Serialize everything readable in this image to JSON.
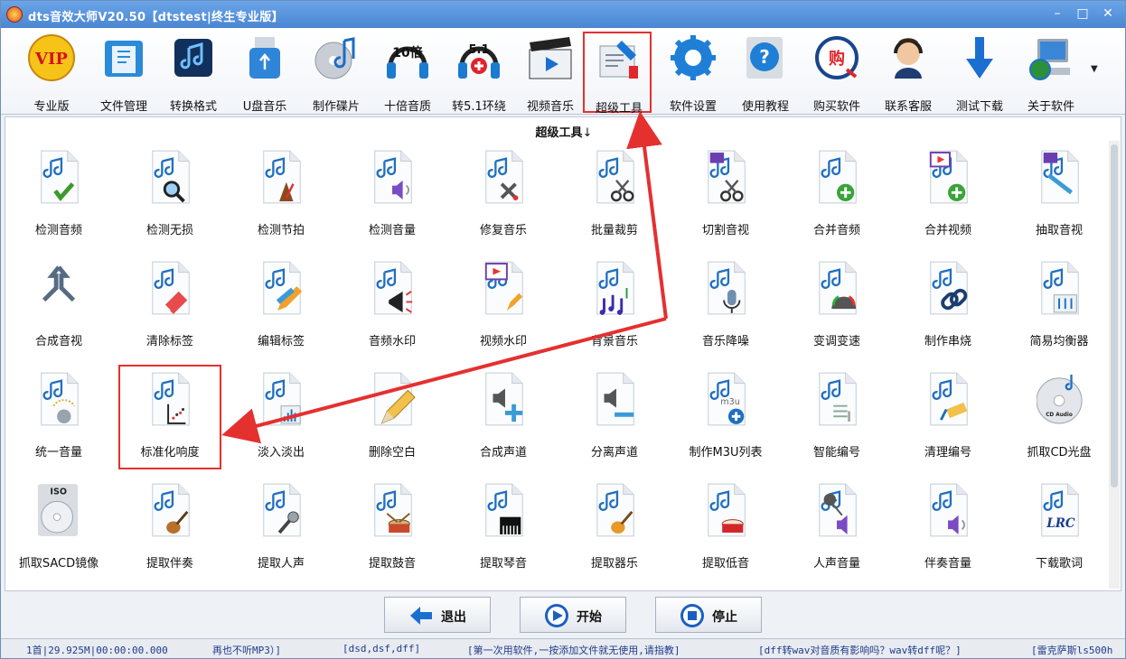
{
  "window": {
    "title": "dts音效大师V20.50【dtstest|终生专业版】",
    "controls": [
      "–",
      "□",
      "✕"
    ]
  },
  "toolbar": {
    "items": [
      {
        "label": "专业版",
        "icon": "vip-icon"
      },
      {
        "label": "文件管理",
        "icon": "folder-icon"
      },
      {
        "label": "转换格式",
        "icon": "music-note-icon"
      },
      {
        "label": "U盘音乐",
        "icon": "usb-drive-icon"
      },
      {
        "label": "制作碟片",
        "icon": "cd-music-icon"
      },
      {
        "label": "十倍音质",
        "icon": "headphones-10x-icon"
      },
      {
        "label": "转5.1环绕",
        "icon": "headphones-51-icon"
      },
      {
        "label": "视频音乐",
        "icon": "clapperboard-icon"
      },
      {
        "label": "超级工具",
        "icon": "super-tools-icon"
      },
      {
        "label": "软件设置",
        "icon": "gear-icon"
      },
      {
        "label": "使用教程",
        "icon": "help-icon"
      },
      {
        "label": "购买软件",
        "icon": "buy-icon"
      },
      {
        "label": "联系客服",
        "icon": "support-agent-icon"
      },
      {
        "label": "测试下载",
        "icon": "download-arrow-icon"
      },
      {
        "label": "关于软件",
        "icon": "computer-globe-icon"
      }
    ],
    "selected": "超级工具",
    "vip_text": "VIP",
    "badge_10": "10倍",
    "badge_51": "5.1",
    "buy_glyph": "购"
  },
  "panel": {
    "title": "超级工具",
    "title_arrow": "↓",
    "tools": [
      {
        "label": "检测音频",
        "glyph": "check"
      },
      {
        "label": "检测无损",
        "glyph": "magnifier"
      },
      {
        "label": "检测节拍",
        "glyph": "metronome"
      },
      {
        "label": "检测音量",
        "glyph": "speaker"
      },
      {
        "label": "修复音乐",
        "glyph": "tools"
      },
      {
        "label": "批量裁剪",
        "glyph": "scissors"
      },
      {
        "label": "切割音视",
        "glyph": "scissors-video"
      },
      {
        "label": "合并音频",
        "glyph": "plus-green"
      },
      {
        "label": "合并视频",
        "glyph": "plus-video"
      },
      {
        "label": "抽取音视",
        "glyph": "extract"
      },
      {
        "label": "合成音视",
        "glyph": "merge-arrows"
      },
      {
        "label": "清除标签",
        "glyph": "eraser"
      },
      {
        "label": "编辑标签",
        "glyph": "pencil"
      },
      {
        "label": "音频水印",
        "glyph": "megaphone"
      },
      {
        "label": "视频水印",
        "glyph": "video-pencil"
      },
      {
        "label": "背景音乐",
        "glyph": "notes"
      },
      {
        "label": "音乐降噪",
        "glyph": "microphone"
      },
      {
        "label": "变调变速",
        "glyph": "gauge"
      },
      {
        "label": "制作串烧",
        "glyph": "chain"
      },
      {
        "label": "简易均衡器",
        "glyph": "equalizer"
      },
      {
        "label": "统一音量",
        "glyph": "dial"
      },
      {
        "label": "标准化响度",
        "glyph": "scatter"
      },
      {
        "label": "淡入淡出",
        "glyph": "bars"
      },
      {
        "label": "删除空白",
        "glyph": "big-pencil"
      },
      {
        "label": "合成声道",
        "glyph": "speaker-plus"
      },
      {
        "label": "分离声道",
        "glyph": "speaker-minus"
      },
      {
        "label": "制作M3U列表",
        "glyph": "m3u"
      },
      {
        "label": "智能编号",
        "glyph": "list"
      },
      {
        "label": "清理编号",
        "glyph": "broom"
      },
      {
        "label": "抓取CD光盘",
        "glyph": "cd-audio"
      },
      {
        "label": "抓取SACD镜像",
        "glyph": "iso-disc"
      },
      {
        "label": "提取伴奏",
        "glyph": "guitar"
      },
      {
        "label": "提取人声",
        "glyph": "mic-silver"
      },
      {
        "label": "提取鼓音",
        "glyph": "drum"
      },
      {
        "label": "提取琴音",
        "glyph": "piano"
      },
      {
        "label": "提取器乐",
        "glyph": "guitar-orange"
      },
      {
        "label": "提取低音",
        "glyph": "drum-red"
      },
      {
        "label": "人声音量",
        "glyph": "mic-speaker"
      },
      {
        "label": "伴奏音量",
        "glyph": "speaker-purple"
      },
      {
        "label": "下载歌词",
        "glyph": "lrc"
      }
    ],
    "highlighted": "标准化响度",
    "iso_text": "ISO",
    "cd_audio_text": "CD Audio",
    "lrc_text": "LRC",
    "m3u_text": "m3u"
  },
  "buttons": {
    "exit": "退出",
    "start": "开始",
    "stop": "停止"
  },
  "status": {
    "segments": [
      "1首|29.925M|00:00:00.000",
      "再也不听MP3）]",
      "[dsd,dsf,dff]",
      "[第一次用软件,一按添加文件就无使用,请指教]",
      "[dff转wav对音质有影响吗？wav转dff呢？]",
      "[雷克萨斯ls500h"
    ]
  },
  "colors": {
    "title_bar": "#4a86d2",
    "highlight_red": "#e53030",
    "status_text": "#1f3c8a",
    "note_blue": "#1f6fc0"
  }
}
